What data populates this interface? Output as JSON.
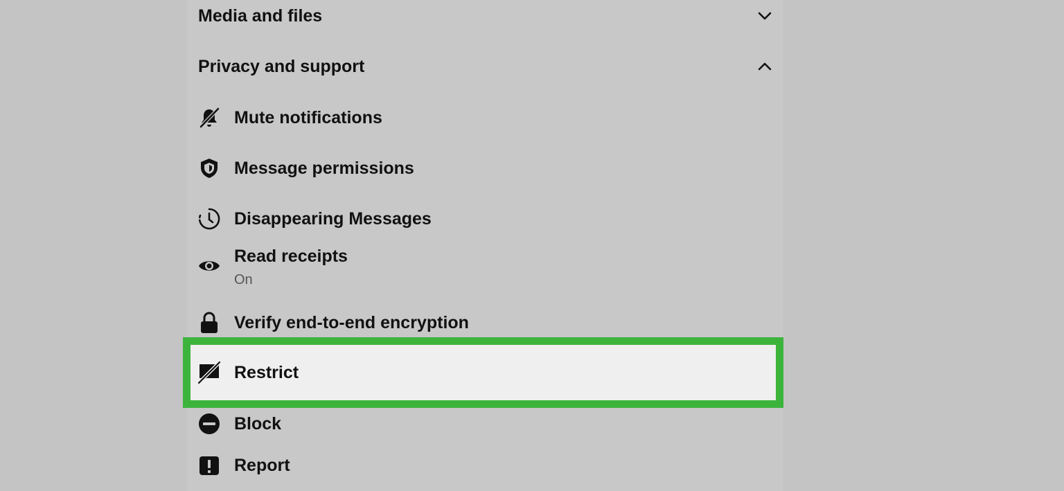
{
  "sections": {
    "media": {
      "label": "Media and files",
      "chevron": "chevron-down-icon"
    },
    "privacy": {
      "label": "Privacy and support",
      "chevron": "chevron-up-icon"
    }
  },
  "privacy_items": {
    "mute": {
      "label": "Mute notifications",
      "icon": "muted-bell-icon"
    },
    "permissions": {
      "label": "Message permissions",
      "icon": "shield-icon"
    },
    "disappearing": {
      "label": "Disappearing Messages",
      "icon": "timer-icon"
    },
    "read_receipts": {
      "label": "Read receipts",
      "status": "On",
      "icon": "eye-icon"
    },
    "verify": {
      "label": "Verify end-to-end encryption",
      "icon": "lock-icon"
    },
    "restrict": {
      "label": "Restrict",
      "icon": "restrict-icon"
    },
    "block": {
      "label": "Block",
      "icon": "block-icon"
    },
    "report": {
      "label": "Report",
      "icon": "report-icon"
    }
  },
  "highlight_color": "#3cb43c"
}
